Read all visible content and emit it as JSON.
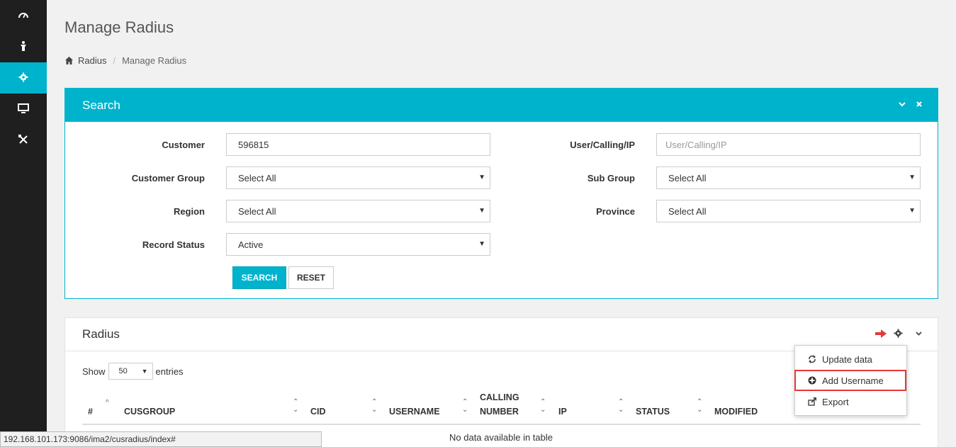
{
  "sidebar": {
    "items": [
      {
        "icon": "dashboard-icon",
        "active": false
      },
      {
        "icon": "user-icon",
        "active": false
      },
      {
        "icon": "gear-icon",
        "active": true
      },
      {
        "icon": "monitor-icon",
        "active": false
      },
      {
        "icon": "tools-icon",
        "active": false
      }
    ]
  },
  "page": {
    "title": "Manage Radius"
  },
  "breadcrumb": {
    "home": "Radius",
    "separator": "/",
    "current": "Manage Radius"
  },
  "search": {
    "title": "Search",
    "customer_label": "Customer",
    "customer_value": "596815",
    "user_label": "User/Calling/IP",
    "user_placeholder": "User/Calling/IP",
    "customer_group_label": "Customer Group",
    "customer_group_value": "Select All",
    "sub_group_label": "Sub Group",
    "sub_group_value": "Select All",
    "region_label": "Region",
    "region_value": "Select All",
    "province_label": "Province",
    "province_value": "Select All",
    "record_status_label": "Record Status",
    "record_status_value": "Active",
    "search_button": "SEARCH",
    "reset_button": "RESET"
  },
  "radius": {
    "title": "Radius",
    "show_label": "Show",
    "entries_value": "50",
    "entries_label": "entries",
    "columns": [
      "#",
      "CUSGROUP",
      "CID",
      "USERNAME",
      "CALLING",
      "NUMBER",
      "IP",
      "STATUS",
      "MODIFIED"
    ],
    "empty_text": "No data available in table"
  },
  "dropdown": {
    "items": [
      "Update data",
      "Add Username",
      "Export"
    ]
  },
  "status_bar": {
    "url": "192.168.101.173:9086/ima2/cusradius/index#"
  },
  "colors": {
    "accent": "#00b3cc",
    "sidebar": "#1f1f1f",
    "highlight": "#e53935"
  }
}
